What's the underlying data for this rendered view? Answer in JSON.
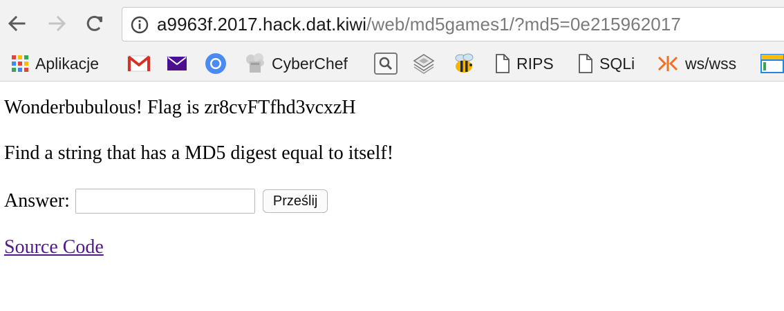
{
  "browser": {
    "url_host": "a9963f.2017.hack.dat.kiwi",
    "url_path": "/web/md5games1/?md5=0e215962017",
    "bookmarks": [
      {
        "label": "Aplikacje",
        "icon": "apps-grid-icon"
      },
      {
        "label": "",
        "icon": "gmail-icon"
      },
      {
        "label": "",
        "icon": "mail-envelope-icon"
      },
      {
        "label": "",
        "icon": "chromium-icon"
      },
      {
        "label": "CyberChef",
        "icon": "cyberchef-icon"
      },
      {
        "label": "",
        "icon": "search-box-icon"
      },
      {
        "label": "",
        "icon": "layers-icon"
      },
      {
        "label": "",
        "icon": "bee-icon"
      },
      {
        "label": "RIPS",
        "icon": "document-icon"
      },
      {
        "label": "SQLi",
        "icon": "document-icon"
      },
      {
        "label": "ws/wss",
        "icon": "ws-arrows-icon"
      },
      {
        "label": "",
        "icon": "window-icon"
      }
    ]
  },
  "page": {
    "flag_text": "Wonderbubulous! Flag is zr8cvFTfhd3vcxzH",
    "task_text": "Find a string that has a MD5 digest equal to itself!",
    "answer_label": "Answer:",
    "answer_value": "",
    "submit_label": "Prześlij",
    "source_link": "Source Code"
  }
}
